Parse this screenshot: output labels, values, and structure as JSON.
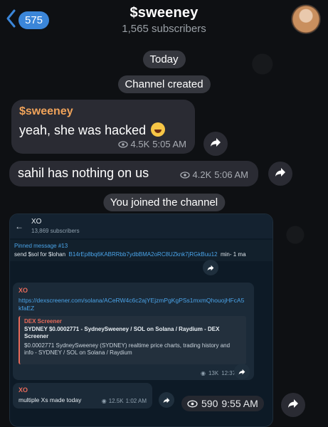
{
  "header": {
    "back_count": "575",
    "channel_name": "$sweeney",
    "subscribers": "1,565 subscribers"
  },
  "date_pill": "Today",
  "service_created": "Channel created",
  "messages": [
    {
      "sender": "$sweeney",
      "text": "yeah, she was hacked",
      "emoji": "laughing-face",
      "views": "4.5K",
      "time": "5:05 AM"
    },
    {
      "text": "sahil has nothing on us",
      "views": "4.2K",
      "time": "5:06 AM"
    }
  ],
  "service_joined": "You joined the channel",
  "screenshot": {
    "channel_name": "XO",
    "subscribers": "13,869 subscribers",
    "pinned_label": "Pinned message #13",
    "pinned_text": "send $sol for $lohan",
    "pinned_address": "B14rEp8bq6KABRRbb7ydbBMA2oRC8UZknk7jRGkBuu12",
    "pinned_suffix": "min- 1 ma",
    "card": {
      "sender": "XO",
      "link": "https://dexscreener.com/solana/ACeRW4c6c2ajYEjzmPgKgPSs1mxmQhouojHFcA5kfaEZ",
      "preview_title": "DEX Screener",
      "preview_heading": "SYDNEY $0.0002771 - SydneySweeney / SOL on Solana / Raydium - DEX Screener",
      "preview_desc": "$0.0002771 SydneySweeney (SYDNEY) realtime price charts, trading history and info - SYDNEY / SOL on Solana / Raydium",
      "views": "13K",
      "time": "12:37 AM"
    },
    "card2": {
      "sender": "XO",
      "text": "multiple Xs made today",
      "views": "12.5K",
      "time": "1:02 AM"
    }
  },
  "screenshot_message_meta": {
    "views": "590",
    "time": "9:55 AM"
  },
  "colors": {
    "accent": "#3b86d9",
    "sender": "#f0a35a",
    "link": "#4aa3e8"
  }
}
